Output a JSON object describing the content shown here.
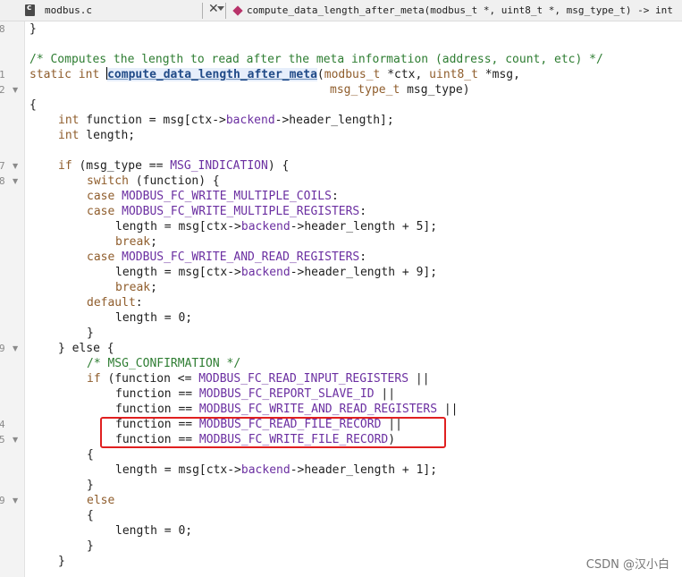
{
  "tab": {
    "file_name": "modbus.c",
    "close_glyph": "✕",
    "function_signature": "compute_data_length_after_meta(modbus_t *, uint8_t *, msg_type_t) -> int"
  },
  "gutter": {
    "line_numbers": [
      "8",
      "",
      "",
      "1",
      "2",
      "",
      "",
      "",
      "",
      "7",
      "8",
      "",
      "",
      "",
      "",
      "",
      "",
      "",
      "",
      "",
      "",
      "",
      "9",
      "",
      "",
      "",
      "",
      "",
      "4",
      "5",
      "",
      "",
      "",
      "9",
      "",
      "",
      "",
      ""
    ]
  },
  "code": {
    "comment_main": "/* Computes the length to read after the meta information (address, count, etc) */",
    "kw_static": "static",
    "kw_int": "int",
    "func_name": "compute_data_length_after_meta",
    "param1_open": "(",
    "type_modbus": "modbus_t",
    "param1": " *ctx, ",
    "type_uint8": "uint8_t",
    "param2": " *msg,",
    "type_msgtype": "msg_type_t",
    "param3": " msg_type)",
    "brace_open": "{",
    "brace_close": "}",
    "else_kw": "else",
    "if_kw": "if",
    "switch_kw": "switch",
    "case_kw": "case",
    "break_kw": "break",
    "default_kw": "default",
    "var_function": " function = msg[ctx->",
    "backend": "backend",
    "header_length": "->header_length];",
    "var_length": " length;",
    "if_cond_open": " (msg_type == ",
    "msg_indication": "MSG_INDICATION",
    "if_cond_close": ") {",
    "switch_rest": " (function) {",
    "fc_write_multiple_coils": "MODBUS_FC_WRITE_MULTIPLE_COILS",
    "fc_write_multiple_registers": "MODBUS_FC_WRITE_MULTIPLE_REGISTERS",
    "fc_write_and_read_registers": "MODBUS_FC_WRITE_AND_READ_REGISTERS",
    "colon": ":",
    "length_assign_prefix": "length = msg[ctx->",
    "length_plus5": "->header_length + 5];",
    "length_plus9": "->header_length + 9];",
    "length_plus1": "->header_length + 1];",
    "semicolon": ";",
    "length_zero": "length = 0;",
    "else_line": "} else {",
    "comment_confirmation": "/* MSG_CONFIRMATION */",
    "if_func_open": " (function <= ",
    "fc_read_input_registers": "MODBUS_FC_READ_INPUT_REGISTERS",
    "or_op": " ||",
    "function_eq": "function == ",
    "fc_report_slave_id": "MODBUS_FC_REPORT_SLAVE_ID",
    "fc_read_file_record": "MODBUS_FC_READ_FILE_RECORD",
    "fc_write_file_record": "MODBUS_FC_WRITE_FILE_RECORD",
    "close_paren": ")"
  },
  "watermark": "CSDN @汉小白",
  "colors": {
    "highlight_box": "#e02020",
    "keyword": "#8f5d2c",
    "comment": "#2e7d32",
    "macro": "#6b2fa1"
  }
}
